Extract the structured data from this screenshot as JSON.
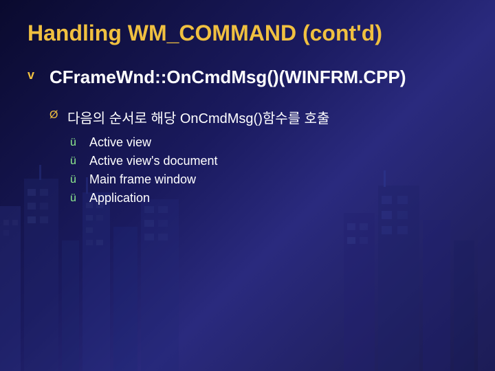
{
  "slide": {
    "title": "Handling WM_COMMAND (cont'd)",
    "main_bullet_marker": "v",
    "function_name": "CFrameWnd::OnCmdMsg()(WINFRM.CPP)",
    "sub_bullet_marker": "Ø",
    "sub_text": "다음의 순서로 해당 OnCmdMsg()함수를 호출",
    "checklist": [
      {
        "label": "Active view"
      },
      {
        "label": "Active view's document"
      },
      {
        "label": "Main frame window"
      },
      {
        "label": "Application"
      }
    ],
    "check_marker": "ü"
  }
}
